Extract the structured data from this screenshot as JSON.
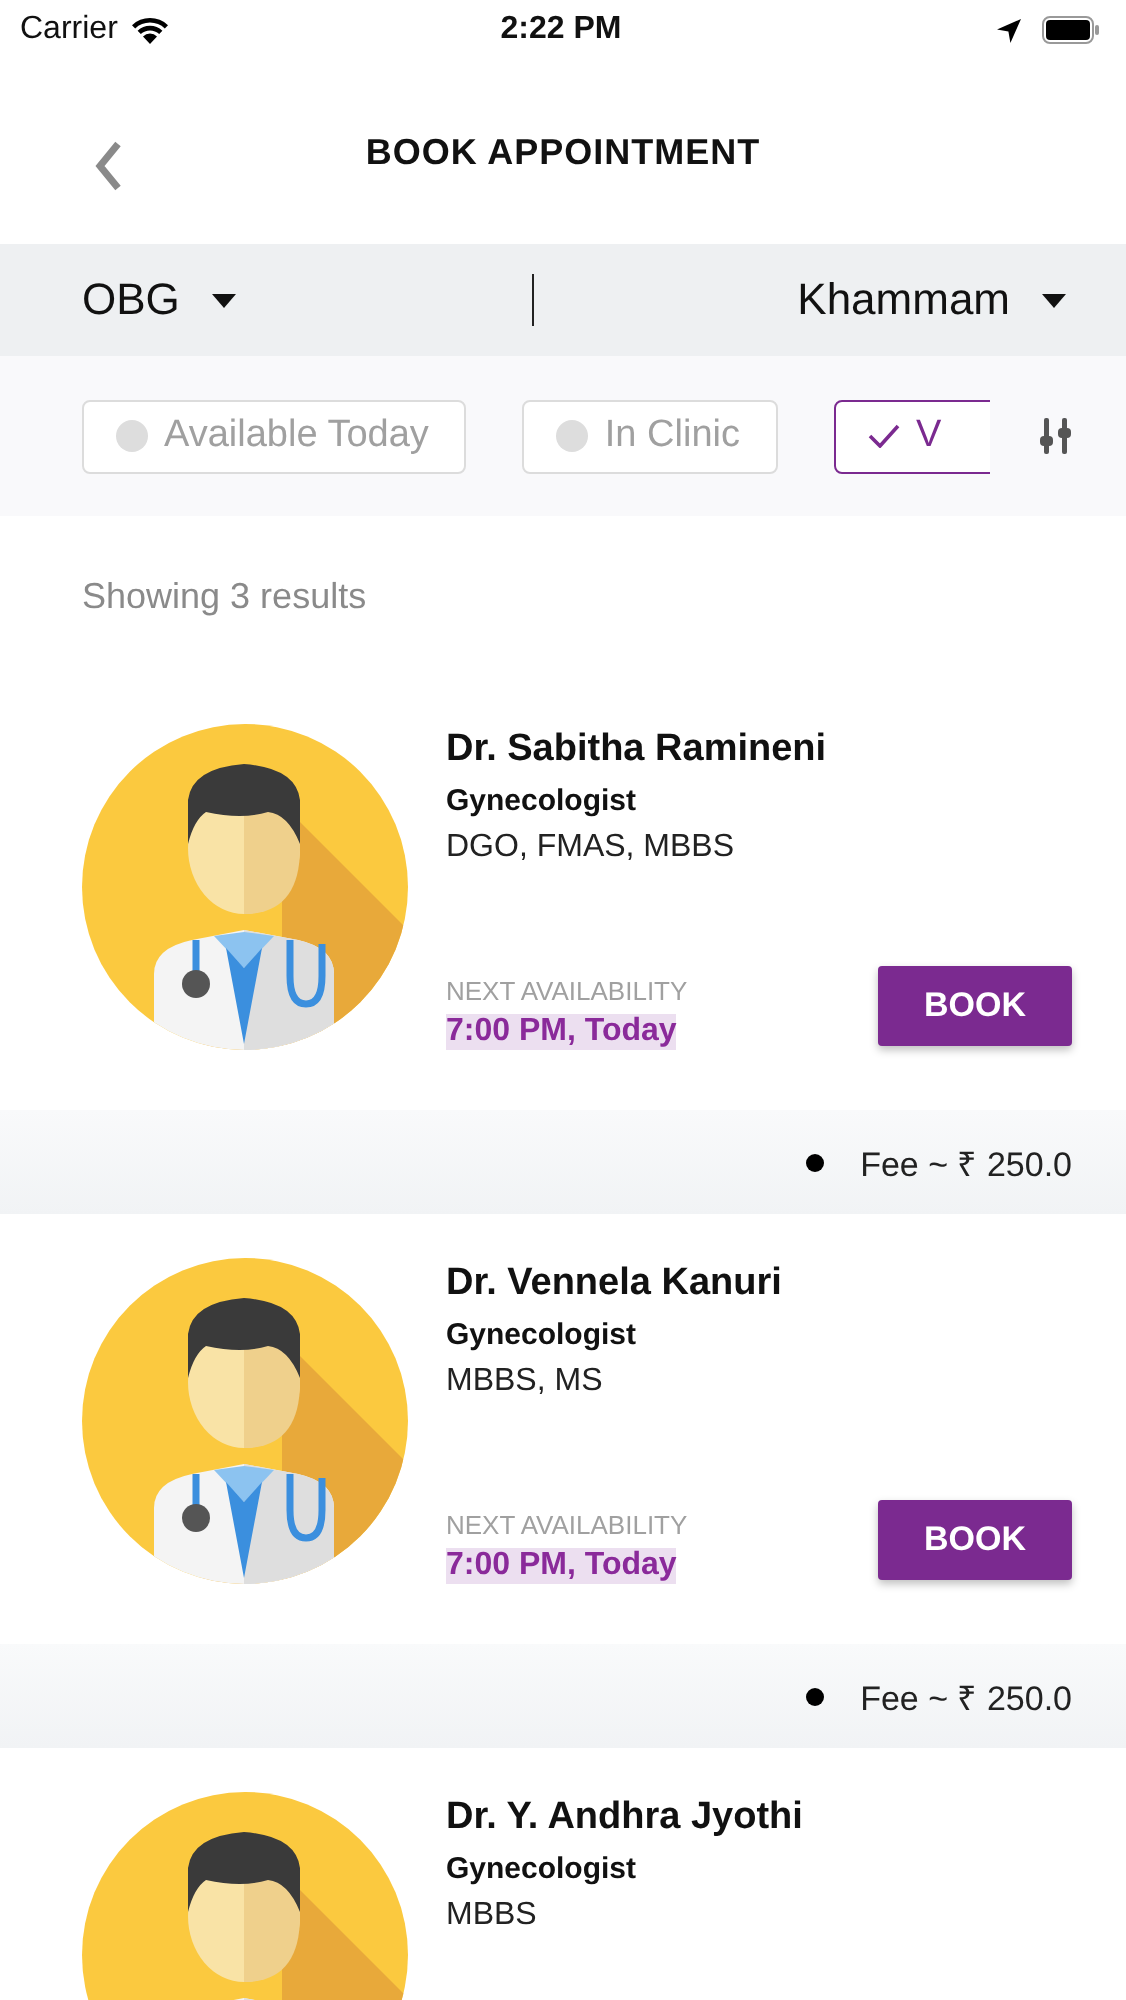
{
  "status_bar": {
    "carrier": "Carrier",
    "time": "2:22 PM"
  },
  "header": {
    "title": "BOOK APPOINTMENT"
  },
  "selectors": {
    "specialty": "OBG",
    "city": "Khammam"
  },
  "filters": [
    {
      "label": "Available Today",
      "selected": false
    },
    {
      "label": "In Clinic",
      "selected": false
    },
    {
      "label": "V",
      "selected": true
    }
  ],
  "results_text": "Showing 3 results",
  "doctors": [
    {
      "name": "Dr. Sabitha Ramineni",
      "specialty": "Gynecologist",
      "degrees": "DGO, FMAS, MBBS",
      "availability_label": "NEXT AVAILABILITY",
      "availability": "7:00 PM, Today",
      "button": "BOOK",
      "fee": "Fee ~ ₹ 250.0"
    },
    {
      "name": "Dr. Vennela Kanuri",
      "specialty": "Gynecologist",
      "degrees": "MBBS, MS",
      "availability_label": "NEXT AVAILABILITY",
      "availability": "7:00 PM, Today",
      "button": "BOOK",
      "fee": "Fee ~ ₹ 250.0"
    },
    {
      "name": "Dr. Y. Andhra Jyothi",
      "specialty": "Gynecologist",
      "degrees": "MBBS"
    }
  ]
}
